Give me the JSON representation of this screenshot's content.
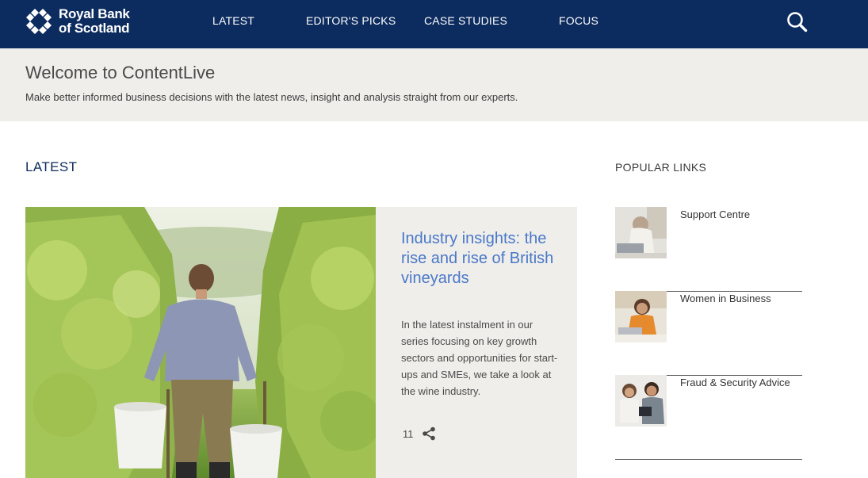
{
  "header": {
    "brand_line1": "Royal Bank",
    "brand_line2": "of Scotland",
    "nav": [
      {
        "label": "LATEST"
      },
      {
        "label": "EDITOR'S PICKS"
      },
      {
        "label": "CASE STUDIES"
      },
      {
        "label": "FOCUS"
      }
    ],
    "search_icon": "search-icon",
    "colors": {
      "bar": "#0c2b5e",
      "text": "#ffffff"
    }
  },
  "welcome": {
    "title": "Welcome to ContentLive",
    "subtitle": "Make better informed business decisions with the latest news, insight and analysis straight from our experts."
  },
  "latest": {
    "heading": "LATEST",
    "feature": {
      "title": "Industry insights: the rise and rise of British vineyards",
      "description": "In the latest instalment in our series focusing on key growth sectors and opportunities for start-ups and SMEs, we take a look at the wine industry.",
      "share_count": "11",
      "share_icon": "share-icon",
      "title_color": "#4a78c8"
    }
  },
  "popular": {
    "heading": "POPULAR LINKS",
    "items": [
      {
        "label": "Support Centre"
      },
      {
        "label": "Women in Business"
      },
      {
        "label": "Fraud & Security Advice"
      }
    ]
  }
}
